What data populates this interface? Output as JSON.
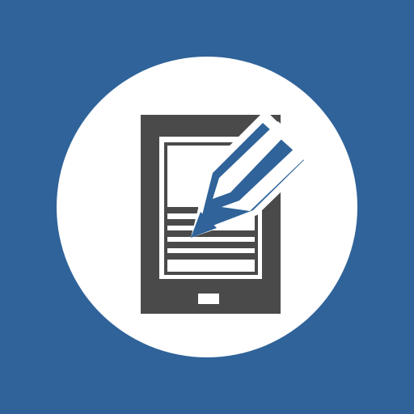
{
  "icon": {
    "name": "tablet-edit-icon",
    "background_color": "#2f6399",
    "circle_color": "#ffffff",
    "tablet_color": "#4a4a4a",
    "screen_color": "#ffffff",
    "pencil_color": "#2f6399",
    "pencil_outline_color": "#ffffff"
  }
}
